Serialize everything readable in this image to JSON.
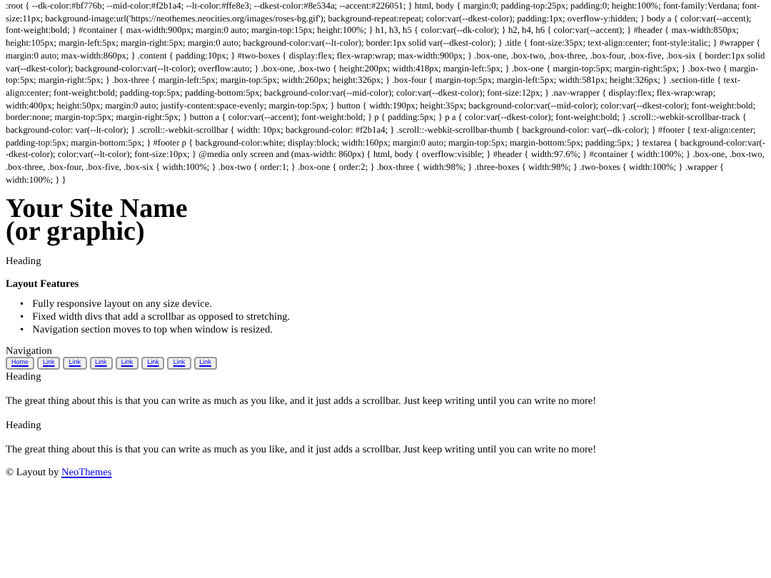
{
  "stylesheet_text": ":root { --dk-color:#bf776b; --mid-color:#f2b1a4; --lt-color:#ffe8e3; --dkest-color:#8e534a; --accent:#226051; } html, body { margin:0; padding-top:25px; padding:0; height:100%; font-family:Verdana; font-size:11px; background-image:url('https://neothemes.neocities.org/images/roses-bg.gif'); background-repeat:repeat; color:var(--dkest-color); padding:1px; overflow-y:hidden; } body a { color:var(--accent); font-weight:bold; } #container { max-width:900px; margin:0 auto; margin-top:15px; height:100%; } h1, h3, h5 { color:var(--dk-color); } h2, h4, h6 { color:var(--accent); } #header { max-width:850px; height:105px; margin-left:5px; margin-right:5px; margin:0 auto; background-color:var(--lt-color); border:1px solid var(--dkest-color); } .title { font-size:35px; text-align:center; font-style:italic; } #wrapper { margin:0 auto; max-width:860px; } .content { padding:10px; } #two-boxes { display:flex; flex-wrap:wrap; max-width:900px; } .box-one, .box-two, .box-three, .box-four, .box-five, .box-six { border:1px solid var(--dkest-color); background-color:var(--lt-color); overflow:auto; } .box-one, .box-two { height:200px; width:418px; margin-left:5px; } .box-one { margin-top:5px; margin-right:5px; } .box-two { margin-top:5px; margin-right:5px; } .box-three { margin-left:5px; margin-top:5px; width:260px; height:326px; } .box-four { margin-top:5px; margin-left:5px; width:581px; height:326px; } .section-title { text-align:center; font-weight:bold; padding-top:5px; padding-bottom:5px; background-color:var(--mid-color); color:var(--dkest-color); font-size:12px; } .nav-wrapper { display:flex; flex-wrap:wrap; width:400px; height:50px; margin:0 auto; justify-content:space-evenly; margin-top:5px; } button { width:190px; height:35px; background-color:var(--mid-color); color:var(--dkest-color); font-weight:bold; border:none; margin-top:5px; margin-right:5px; } button a { color:var(--accent); font-weight:bold; } p { padding:5px; } p a { color:var(--dkest-color); font-weight:bold; } .scroll::-webkit-scrollbar-track { background-color: var(--lt-color); } .scroll::-webkit-scrollbar { width: 10px; background-color: #f2b1a4; } .scroll::-webkit-scrollbar-thumb { background-color: var(--dk-color); } #footer { text-align:center; padding-top:5px; margin-bottom:5px; } #footer p { background-color:white; display:block; width:160px; margin:0 auto; margin-top:5px; margin-bottom:5px; padding:5px; } textarea { background-color:var(--dkest-color); color:var(--lt-color); font-size:10px; } @media only screen and (max-width: 860px) { html, body { overflow:visible; } #header { width:97.6%; } #container { width:100%; } .box-one, .box-two, .box-three, .box-four, .box-five, .box-six { width:100%; } .box-two { order:1; } .box-one { order:2; } .box-three { width:98%; } .three-boxes { width:98%; } .two-boxes { width:100%; } .wrapper { width:100%; } }",
  "site_title": [
    "Your Site Name",
    "(or graphic)"
  ],
  "intro": {
    "heading": "Heading",
    "subheading": "Layout Features",
    "bullet": "•",
    "features": [
      "Fully responsive layout on any size device.",
      "Fixed width divs that add a scrollbar as opposed to stretching.",
      "Navigation section moves to top when window is resized."
    ]
  },
  "navigation": {
    "title": "Navigation",
    "buttons": [
      "Home",
      "Link",
      "Link",
      "Link",
      "Link",
      "Link",
      "Link",
      "Link"
    ]
  },
  "sections": [
    {
      "heading": "Heading",
      "text": "The great thing about this is that you can write as much as you like, and it just adds a scrollbar. Just keep writing until you can write no more!"
    },
    {
      "heading": "Heading",
      "text": "The great thing about this is that you can write as much as you like, and it just adds a scrollbar. Just keep writing until you can write no more!"
    }
  ],
  "footer": {
    "text": "© Layout by",
    "link": "NeoThemes"
  }
}
